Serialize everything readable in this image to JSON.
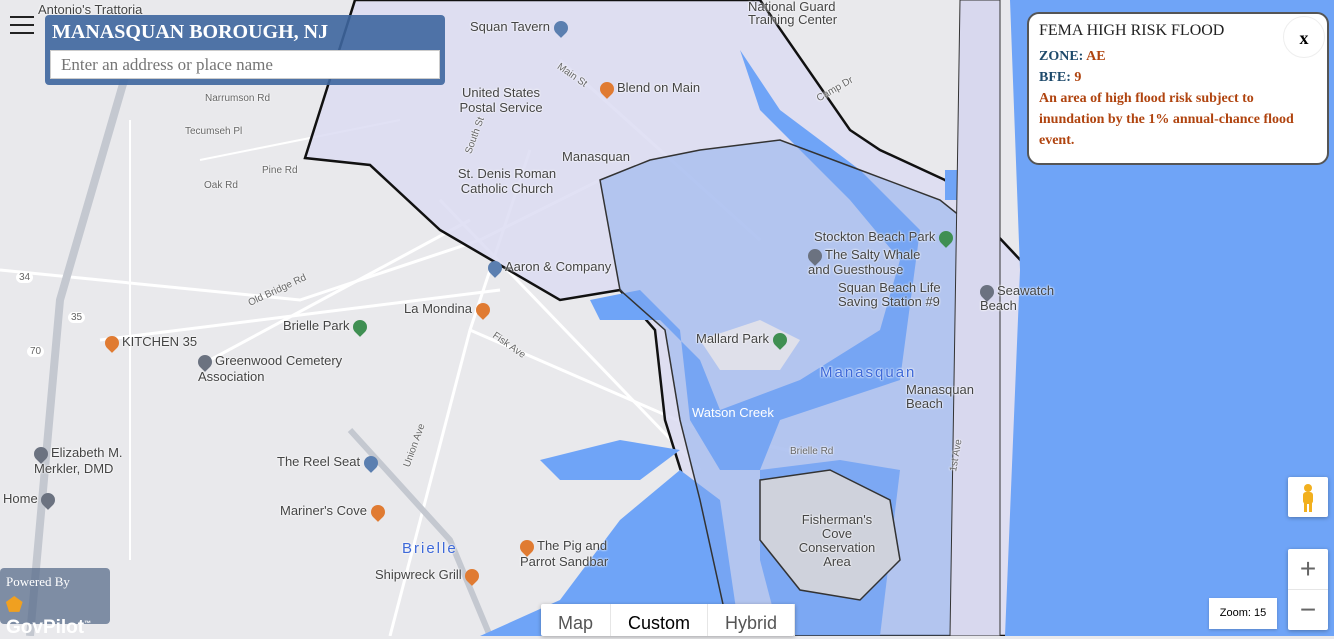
{
  "header": {
    "title": "MANASQUAN BOROUGH, NJ",
    "search_placeholder": "Enter an address or place name"
  },
  "popup": {
    "title": "FEMA HIGH RISK FLOOD",
    "close_label": "x",
    "zone_label": "ZONE:",
    "zone_value": "AE",
    "bfe_label": "BFE:",
    "bfe_value": "9",
    "description": "An area of high flood risk subject to inundation by the 1% annual-chance flood event."
  },
  "branding": {
    "powered_by": "Powered By",
    "brand": "GovPilot",
    "tm": "™"
  },
  "map_types": [
    {
      "label": "Map"
    },
    {
      "label": "Custom",
      "active": true
    },
    {
      "label": "Hybrid"
    }
  ],
  "zoom": {
    "label": "Zoom: 15",
    "in": "+",
    "out": "−"
  },
  "colors": {
    "water": "#6fa4f7",
    "flood_zone": "#7fa6ee",
    "borough_fill": "#dcdcf2",
    "title_bg": "#3e669e",
    "popup_value": "#b0440f",
    "popup_key": "#1e4a6b"
  },
  "places": {
    "antonios": "Antonio's Trattoria",
    "squan_tavern": "Squan Tavern",
    "post_office": "United States Postal Service",
    "blend": "Blend on Main",
    "manasquan_station": "Manasquan",
    "st_denis": "St. Denis Roman Catholic Church",
    "aaron": "Aaron & Company",
    "la_mondina": "La Mondina",
    "brielle_park": "Brielle Park",
    "kitchen35": "KITCHEN 35",
    "greenwood": "Greenwood Cemetery Association",
    "merkler": "Elizabeth M. Merkler, DMD",
    "home": "Home",
    "reel_seat": "The Reel Seat",
    "mariners": "Mariner's Cove",
    "brielle": "Brielle",
    "pig_parrot": "The Pig and Parrot Sandbar",
    "shipwreck": "Shipwreck Grill",
    "mallard": "Mallard Park",
    "manasquan_town": "Manasquan",
    "stockton": "Stockton Beach Park",
    "salty_whale": "The Salty Whale and Guesthouse",
    "squan_beach": "Squan Beach Life Saving Station #9",
    "seawatch": "Seawatch Beach",
    "manasquan_beach": "Manasquan Beach",
    "fishermans": "Fisherman's Cove Conservation Area",
    "training": "National Guard Training Center",
    "watson_creek": "Watson Creek"
  },
  "streets": {
    "main_st": "Main St",
    "south_st": "South St",
    "union_ave": "Union Ave",
    "fisk_ave": "Fisk Ave",
    "old_bridge": "Old Bridge Rd",
    "brielle_rd": "Brielle Rd",
    "first_ave": "1st Ave",
    "camp_dr": "Camp Dr",
    "oak_rd": "Oak Rd",
    "pine_rd": "Pine Rd",
    "narrumson": "Narrumson Rd",
    "tecumseh": "Tecumseh Pl",
    "r34": "34",
    "r35": "35",
    "r70": "70"
  }
}
